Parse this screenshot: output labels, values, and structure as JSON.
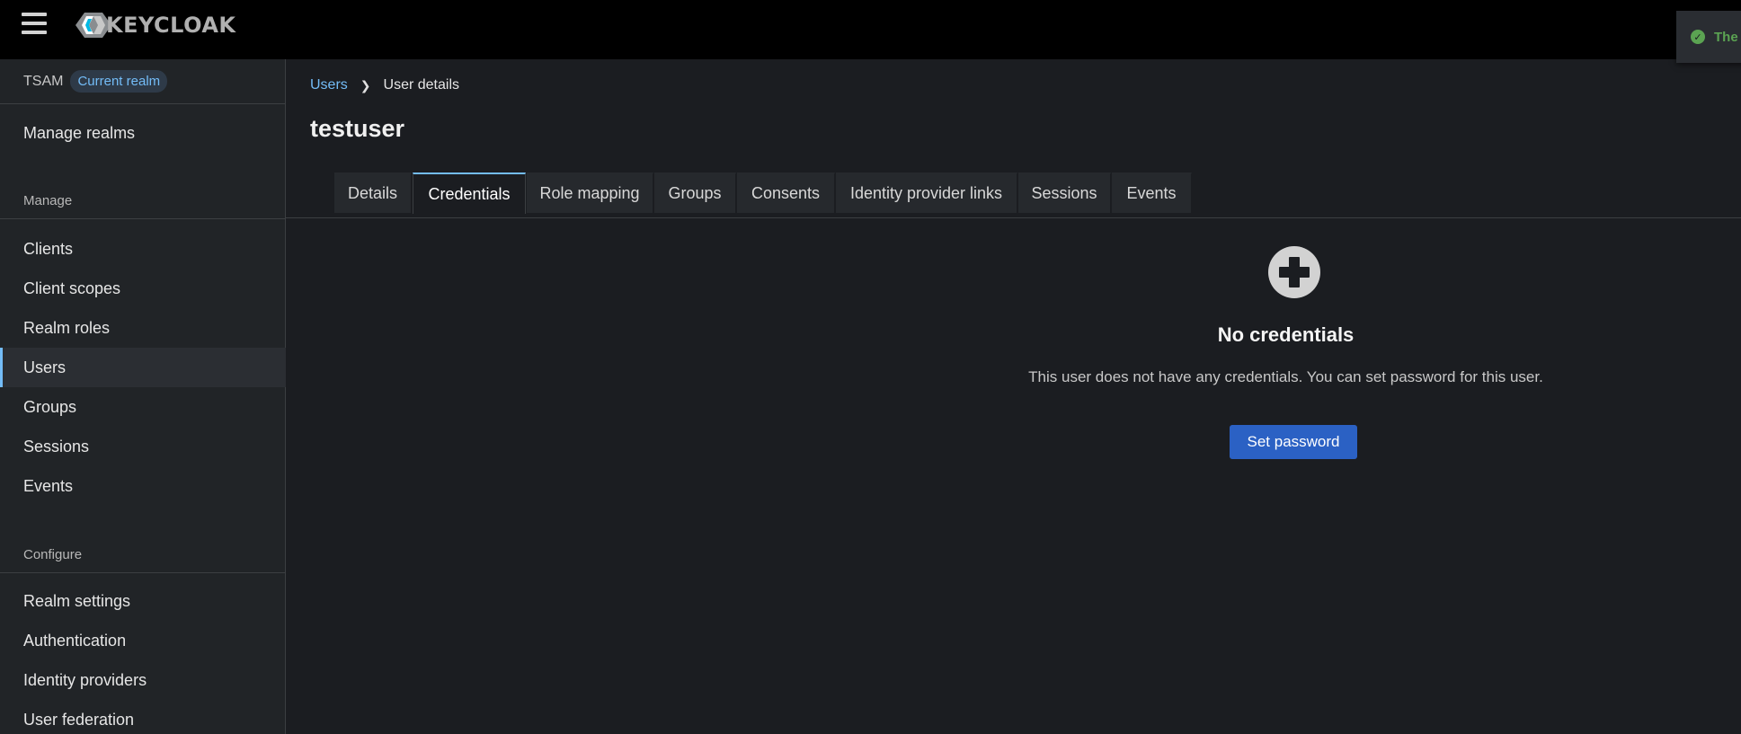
{
  "masthead": {
    "logo_text": "KEYCLOAK",
    "toast_text": "The"
  },
  "sidebar": {
    "realm_name": "TSAM",
    "realm_badge": "Current realm",
    "manage_realms": "Manage realms",
    "sections": {
      "manage": "Manage",
      "configure": "Configure"
    },
    "manage_items": [
      {
        "label": "Clients"
      },
      {
        "label": "Client scopes"
      },
      {
        "label": "Realm roles"
      },
      {
        "label": "Users"
      },
      {
        "label": "Groups"
      },
      {
        "label": "Sessions"
      },
      {
        "label": "Events"
      }
    ],
    "configure_items": [
      {
        "label": "Realm settings"
      },
      {
        "label": "Authentication"
      },
      {
        "label": "Identity providers"
      },
      {
        "label": "User federation"
      }
    ],
    "active_item": "Users"
  },
  "breadcrumb": {
    "parent": "Users",
    "current": "User details"
  },
  "page_title": "testuser",
  "tabs": [
    {
      "label": "Details"
    },
    {
      "label": "Credentials"
    },
    {
      "label": "Role mapping"
    },
    {
      "label": "Groups"
    },
    {
      "label": "Consents"
    },
    {
      "label": "Identity provider links"
    },
    {
      "label": "Sessions"
    },
    {
      "label": "Events"
    }
  ],
  "active_tab": "Credentials",
  "empty_state": {
    "title": "No credentials",
    "body": "This user does not have any credentials. You can set password for this user.",
    "action": "Set password"
  },
  "colors": {
    "accent": "#73bcf7",
    "primary_button": "#2b61c4",
    "success": "#5ba352"
  }
}
